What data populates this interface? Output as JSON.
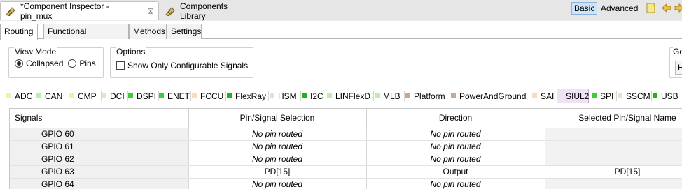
{
  "editor_tabs": [
    {
      "label": "*Component Inspector - pin_mux",
      "close": "☒"
    },
    {
      "label": "Components Library"
    }
  ],
  "mode": {
    "basic": "Basic",
    "advanced": "Advanced"
  },
  "sub_tabs": [
    "Routing",
    "Functional Properties",
    "Methods",
    "Settings"
  ],
  "view_mode": {
    "title": "View Mode",
    "collapsed": "Collapsed",
    "pins": "Pins",
    "selected": "Collapsed"
  },
  "options": {
    "title": "Options",
    "show_only_configurable": "Show Only Configurable Signals",
    "checked": false
  },
  "cut_off_group": {
    "title_fragment": "Ge",
    "field_fragment": "H"
  },
  "categories": [
    {
      "label": "ADC",
      "color": "#f2f2a0"
    },
    {
      "label": "CAN",
      "color": "#b8f0a8"
    },
    {
      "label": "CMP",
      "color": "#f2f2a0"
    },
    {
      "label": "DCI",
      "color": "#f7dcc4"
    },
    {
      "label": "DSPI",
      "color": "#3ccc3c"
    },
    {
      "label": "ENET",
      "color": "#3ccc3c"
    },
    {
      "label": "FCCU",
      "color": "#f7dcc4"
    },
    {
      "label": "FlexRay",
      "color": "#20b020"
    },
    {
      "label": "HSM",
      "color": "#f7dcc4"
    },
    {
      "label": "I2C",
      "color": "#20b020"
    },
    {
      "label": "LINFlexD",
      "color": "#b8f0a8"
    },
    {
      "label": "MLB",
      "color": "#b8f0a8"
    },
    {
      "label": "Platform",
      "color": "#c9a88c"
    },
    {
      "label": "PowerAndGround",
      "color": "#c9a88c"
    },
    {
      "label": "SAI",
      "color": "#f7dcc4"
    },
    {
      "label": "SIUL2",
      "color": "#efe2f7"
    },
    {
      "label": "SPI",
      "color": "#3ccc3c"
    },
    {
      "label": "SSCM",
      "color": "#f7dcc4"
    },
    {
      "label": "USB",
      "color": "#20b020"
    }
  ],
  "active_category": "SIUL2",
  "table": {
    "headers": [
      "Signals",
      "Pin/Signal Selection",
      "Direction",
      "Selected Pin/Signal Name"
    ],
    "rows": [
      {
        "signal": "GPIO 60",
        "pin": "No pin routed",
        "direction": "No pin routed",
        "selected": ""
      },
      {
        "signal": "GPIO 61",
        "pin": "No pin routed",
        "direction": "No pin routed",
        "selected": ""
      },
      {
        "signal": "GPIO 62",
        "pin": "No pin routed",
        "direction": "No pin routed",
        "selected": ""
      },
      {
        "signal": "GPIO 63",
        "pin": "PD[15]",
        "direction": "Output",
        "selected": "PD[15]"
      },
      {
        "signal": "GPIO 64",
        "pin": "No pin routed",
        "direction": "No pin routed",
        "selected": ""
      }
    ]
  }
}
